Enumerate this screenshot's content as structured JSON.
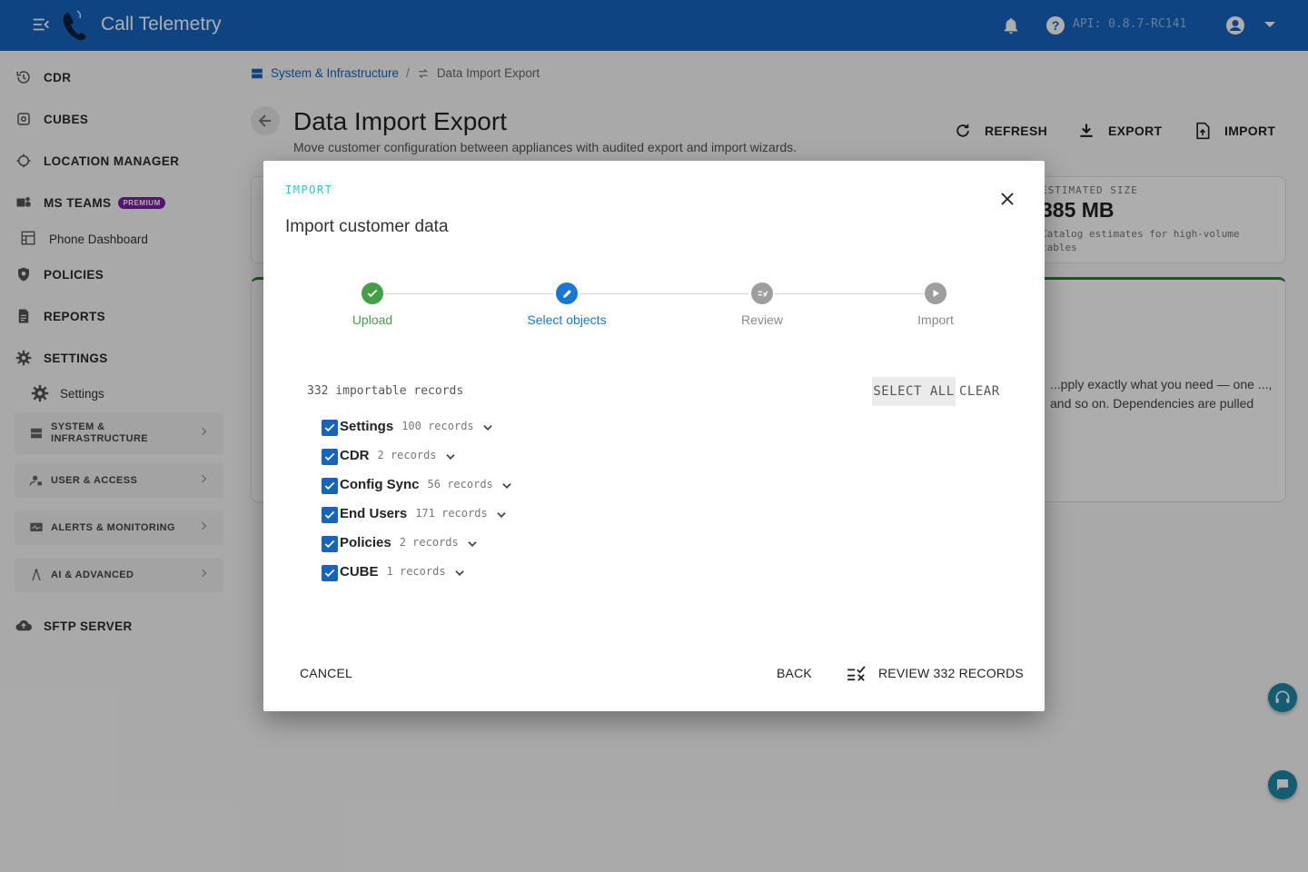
{
  "app": {
    "title": "Call Telemetry",
    "api_version": "API: 0.8.7-RC141"
  },
  "sidebar": {
    "items": [
      {
        "label": "CDR",
        "icon": "history-icon"
      },
      {
        "label": "CUBES",
        "icon": "cubes-icon"
      },
      {
        "label": "LOCATION MANAGER",
        "icon": "location-icon"
      },
      {
        "label": "MS TEAMS",
        "icon": "teams-icon",
        "badge": "PREMIUM"
      },
      {
        "label": "Phone Dashboard",
        "icon": "dashboard-icon"
      },
      {
        "label": "POLICIES",
        "icon": "shield-icon"
      },
      {
        "label": "REPORTS",
        "icon": "report-icon"
      },
      {
        "label": "SETTINGS",
        "icon": "gear-icon"
      },
      {
        "label": "Settings",
        "icon": "gear-icon"
      },
      {
        "label": "SFTP SERVER",
        "icon": "cloud-upload-icon"
      }
    ],
    "groups": [
      {
        "label": "SYSTEM & INFRASTRUCTURE"
      },
      {
        "label": "USER & ACCESS"
      },
      {
        "label": "ALERTS & MONITORING"
      },
      {
        "label": "AI & ADVANCED"
      }
    ]
  },
  "breadcrumb": {
    "parent": "System & Infrastructure",
    "current": "Data Import Export"
  },
  "page": {
    "title": "Data Import Export",
    "subtitle": "Move customer configuration between appliances with audited export and import wizards.",
    "actions": {
      "refresh": "REFRESH",
      "export": "EXPORT",
      "import": "IMPORT"
    }
  },
  "estimate": {
    "label": "ESTIMATED SIZE",
    "value": "385 MB",
    "note": "Catalog estimates for high-volume tables"
  },
  "info_text": "...pply exactly what you need — one ..., and so on. Dependencies are pulled",
  "dialog": {
    "kicker": "IMPORT",
    "title": "Import customer data",
    "steps": [
      {
        "label": "Upload",
        "state": "complete"
      },
      {
        "label": "Select objects",
        "state": "active"
      },
      {
        "label": "Review",
        "state": "pending"
      },
      {
        "label": "Import",
        "state": "pending"
      }
    ],
    "count_text": "332 importable records",
    "select_all": "SELECT ALL",
    "clear": "CLEAR",
    "objects": [
      {
        "name": "Settings",
        "count": "100 records",
        "checked": true
      },
      {
        "name": "CDR",
        "count": "2 records",
        "checked": true
      },
      {
        "name": "Config Sync",
        "count": "56 records",
        "checked": true
      },
      {
        "name": "End Users",
        "count": "171 records",
        "checked": true
      },
      {
        "name": "Policies",
        "count": "2 records",
        "checked": true
      },
      {
        "name": "CUBE",
        "count": "1 records",
        "checked": true
      }
    ],
    "buttons": {
      "cancel": "CANCEL",
      "back": "BACK",
      "review": "REVIEW 332 RECORDS"
    }
  },
  "colors": {
    "primary": "#1565c0",
    "success": "#43a047",
    "accent": "#26c6da",
    "premium": "#7b1fa2"
  }
}
